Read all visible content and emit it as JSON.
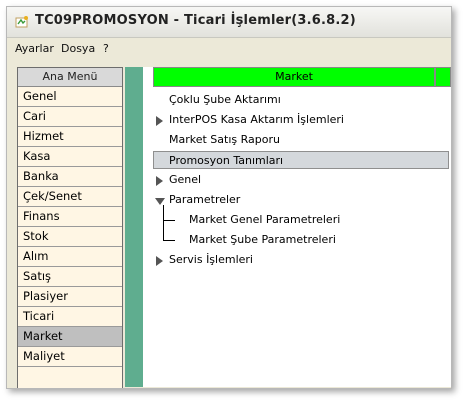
{
  "window": {
    "title": "TC09PROMOSYON - Ticari İşlemler(3.6.8.2)"
  },
  "menubar": [
    "Ayarlar",
    "Dosya",
    "?"
  ],
  "left_menu": {
    "header": "Ana Menü",
    "items": [
      "Genel",
      "Cari",
      "Hizmet",
      "Kasa",
      "Banka",
      "Çek/Senet",
      "Finans",
      "Stok",
      "Alım",
      "Satış",
      "Plasiyer",
      "Ticari",
      "Market",
      "Maliyet"
    ],
    "active": "Market"
  },
  "content": {
    "header": "Market",
    "tree": [
      {
        "label": "Çoklu Şube Aktarımı"
      },
      {
        "label": "InterPOS Kasa Aktarım İşlemleri"
      },
      {
        "label": "Market Satış Raporu"
      },
      {
        "label": "Promosyon Tanımları"
      },
      {
        "label": "Genel"
      },
      {
        "label": "Parametreler"
      },
      {
        "label": "Market Genel Parametreleri"
      },
      {
        "label": "Market Şube Parametreleri"
      },
      {
        "label": "Servis İşlemleri"
      }
    ]
  },
  "colors": {
    "header_green": "#00ff00",
    "divider_teal": "#5fad8f",
    "menu_bg": "#fff6e4",
    "active_item": "#bfbfbf"
  }
}
